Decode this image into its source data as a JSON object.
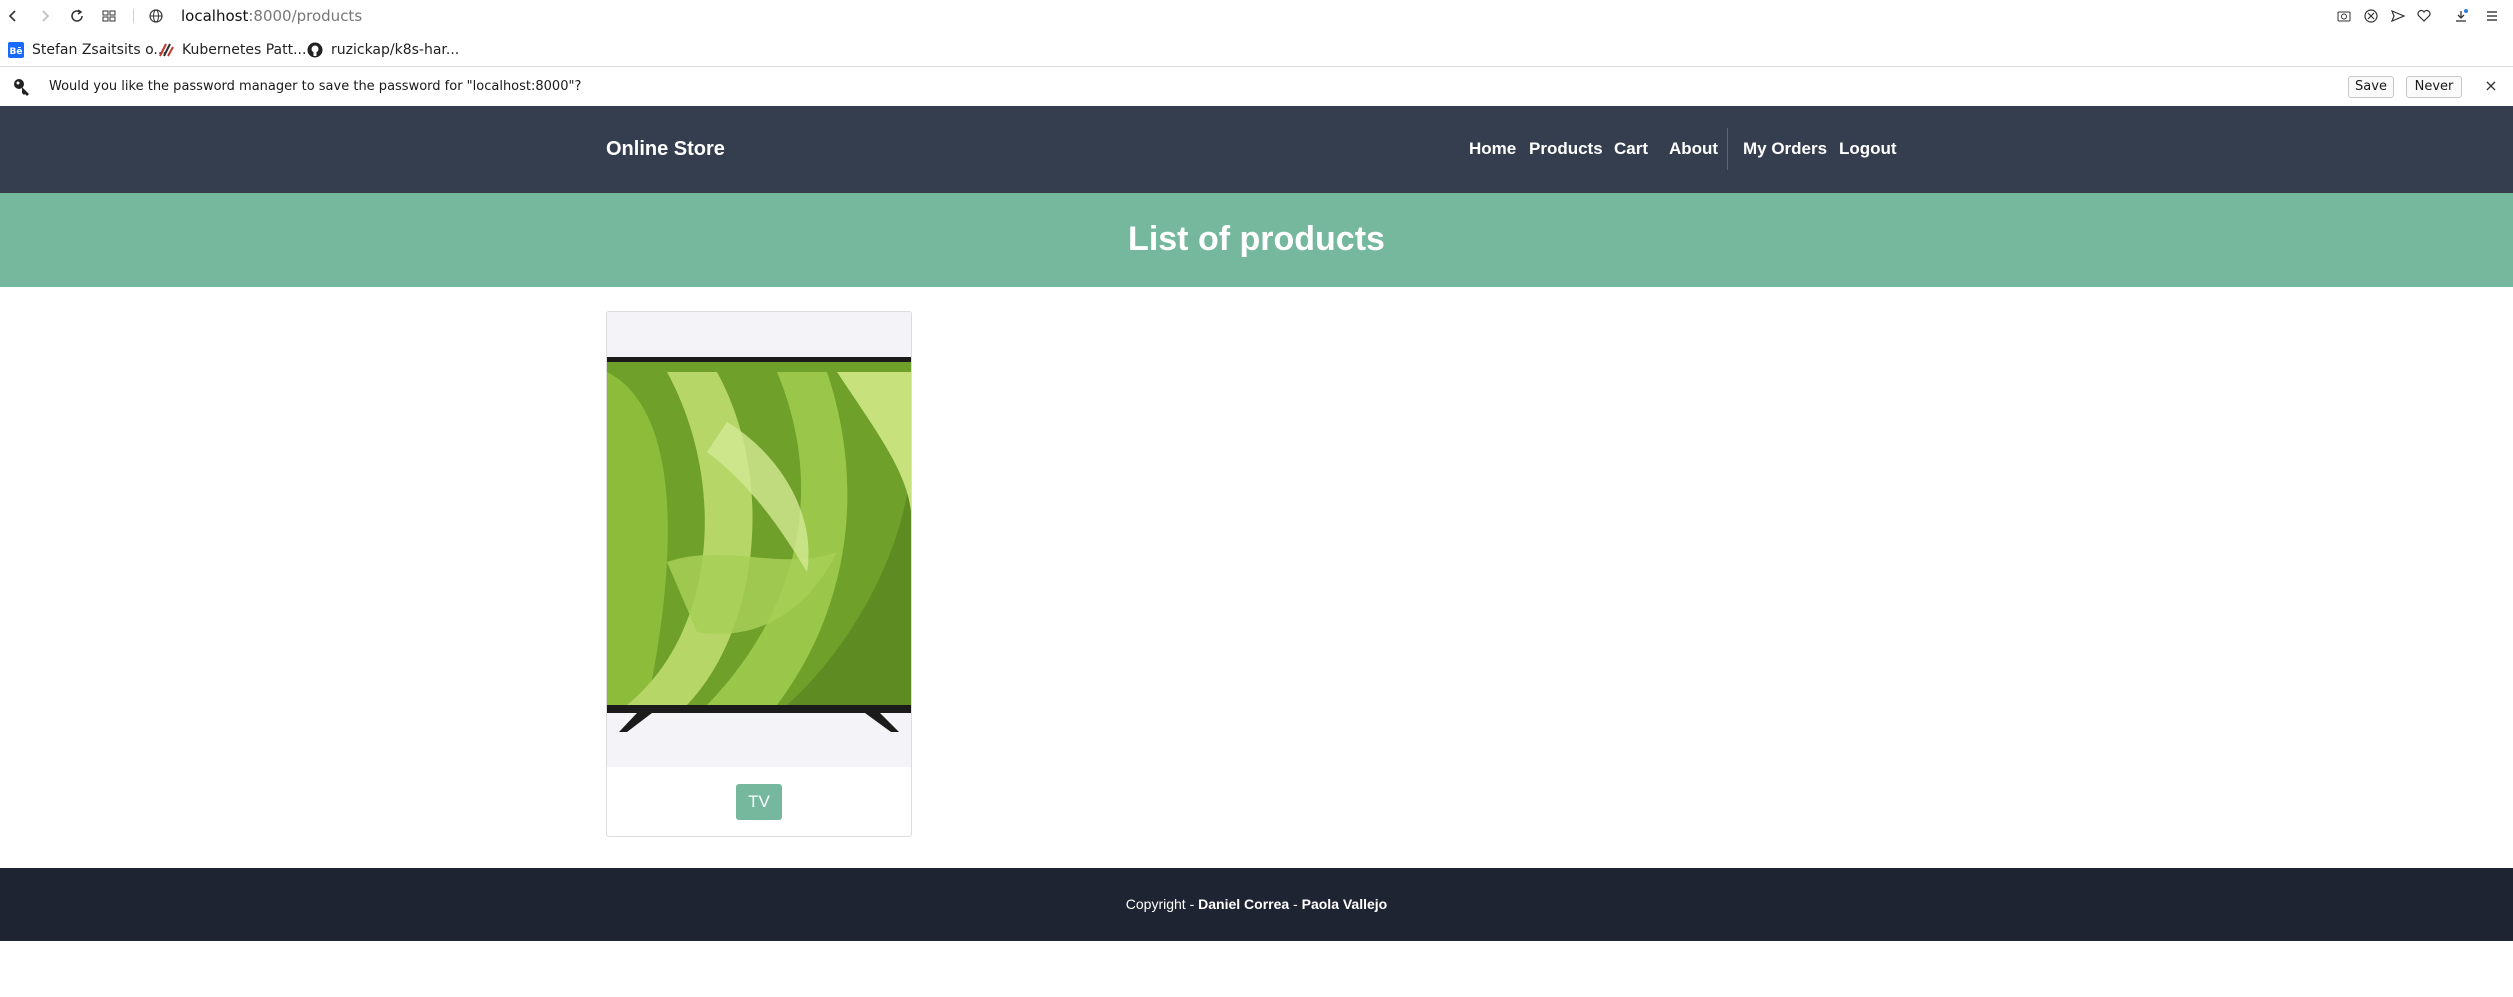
{
  "browser": {
    "url_host": "localhost",
    "url_path": ":8000/products",
    "bookmarks": [
      {
        "label": "Stefan Zsaitsits o...",
        "icon": "behance-icon"
      },
      {
        "label": "Kubernetes Patt...",
        "icon": "kubernetes-patterns-icon"
      },
      {
        "label": "ruzickap/k8s-har...",
        "icon": "github-icon"
      }
    ],
    "password_prompt": {
      "text": "Would you like the password manager to save the password for \"localhost:8000\"?",
      "save_label": "Save",
      "never_label": "Never",
      "close_label": "×"
    }
  },
  "navbar": {
    "brand": "Online Store",
    "items": [
      {
        "label": "Home"
      },
      {
        "label": "Products"
      },
      {
        "label": "Cart"
      },
      {
        "label": "About"
      },
      {
        "label": "My Orders"
      },
      {
        "label": "Logout"
      }
    ]
  },
  "header": {
    "title": "List of products"
  },
  "products": [
    {
      "name": "TV"
    }
  ],
  "footer": {
    "prefix": "Copyright - ",
    "author1": "Daniel Correa",
    "separator": " - ",
    "author2": "Paola Vallejo"
  },
  "colors": {
    "navbar": "#343e4f",
    "accent": "#76b89d",
    "footer": "#1e2431"
  }
}
